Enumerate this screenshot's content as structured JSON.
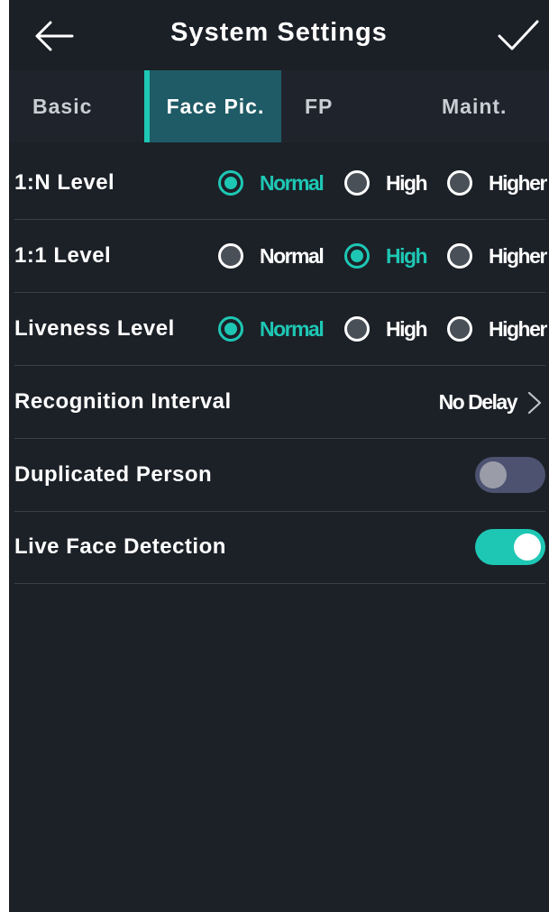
{
  "header": {
    "title": "System Settings",
    "back_icon": "arrow-left-icon",
    "confirm_icon": "checkmark-icon"
  },
  "tabs": [
    {
      "label": "Basic",
      "active": false
    },
    {
      "label": "Face Pic.",
      "active": true
    },
    {
      "label": "FP",
      "active": false
    },
    {
      "label": "Maint.",
      "active": false
    }
  ],
  "settings": {
    "n_level": {
      "label": "1:N Level",
      "options": [
        "Normal",
        "High",
        "Higher"
      ],
      "selected": "Normal"
    },
    "one_level": {
      "label": "1:1 Level",
      "options": [
        "Normal",
        "High",
        "Higher"
      ],
      "selected": "High"
    },
    "liveness_level": {
      "label": "Liveness Level",
      "options": [
        "Normal",
        "High",
        "Higher"
      ],
      "selected": "Normal"
    },
    "recognition_interval": {
      "label": "Recognition Interval",
      "value": "No Delay"
    },
    "duplicated_person": {
      "label": "Duplicated Person",
      "enabled": false
    },
    "live_face_detection": {
      "label": "Live Face Detection",
      "enabled": true
    }
  },
  "colors": {
    "accent": "#1ec7b4",
    "background": "#1c2128",
    "tab_active": "#1f5b66",
    "toggle_off": "#4d5270"
  }
}
